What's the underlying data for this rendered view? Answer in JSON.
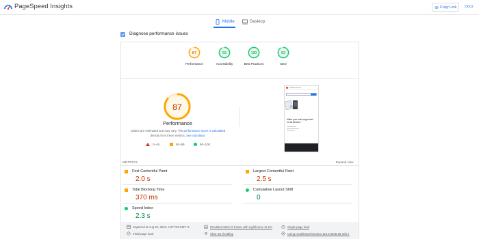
{
  "header": {
    "title": "PageSpeed Insights",
    "copy_link": "Copy Link",
    "docs": "Docs"
  },
  "tabs": [
    {
      "label": "Mobile",
      "active": true
    },
    {
      "label": "Desktop",
      "active": false
    }
  ],
  "diagnose": {
    "title": "Diagnose performance issues"
  },
  "categories": [
    {
      "label": "Performance",
      "score": 87,
      "color": "#ffa400"
    },
    {
      "label": "Accessibility",
      "score": 92,
      "color": "#0cce6b"
    },
    {
      "label": "Best Practices",
      "score": 100,
      "color": "#0cce6b"
    },
    {
      "label": "SEO",
      "score": 92,
      "color": "#0cce6b"
    }
  ],
  "performance": {
    "score": 87,
    "title": "Performance",
    "note_prefix": "Values are estimated and may vary. The",
    "note_link": "performance score is calculated",
    "note_mid": "directly from these metrics.",
    "note_link2": "See calculator.",
    "legend": [
      "0–49",
      "50–89",
      "90–100"
    ]
  },
  "screenshot": {
    "app_name": "PageSpeed Insights",
    "headline": "Make your web pages fast on all devices."
  },
  "metrics": {
    "label": "METRICS",
    "expand": "Expand view",
    "items": [
      {
        "name": "First Contentful Paint",
        "value": "2.0 s",
        "rating": "average",
        "color": "#c33300"
      },
      {
        "name": "Largest Contentful Paint",
        "value": "2.5 s",
        "rating": "average",
        "color": "#c33300"
      },
      {
        "name": "Total Blocking Time",
        "value": "370 ms",
        "rating": "average",
        "color": "#c33300"
      },
      {
        "name": "Cumulative Layout Shift",
        "value": "0",
        "rating": "good",
        "color": "#018642"
      },
      {
        "name": "Speed Index",
        "value": "2.3 s",
        "rating": "good",
        "color": "#018642"
      }
    ]
  },
  "runtime": {
    "captured": "Captured at Aug 20, 2023, 4:37 PM GMT+1",
    "device": "Emulated Moto G Power with Lighthouse 11.0.0",
    "session": "Single page load",
    "initial": "Initial page load",
    "throttling": "Slow 4G throttling",
    "browser": "Using HeadlessChromium 115.0.5845.96 with lr"
  },
  "colors": {
    "accent": "#1a73e8",
    "average": "#ffa400",
    "good": "#0cce6b",
    "poor": "#d93025"
  }
}
